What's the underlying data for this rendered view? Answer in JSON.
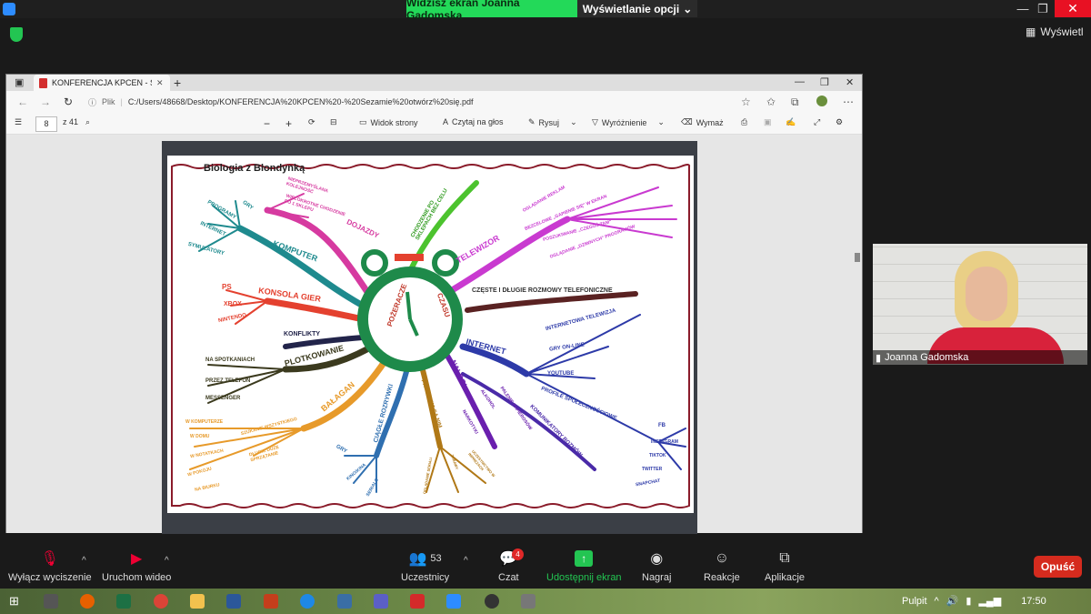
{
  "zoom": {
    "share_banner": "Widzisz ekran Joanna Gadomska",
    "view_options": "Wyświetlanie opcji",
    "view_button": "Wyświetl",
    "participant_name": "Joanna Gadomska",
    "toolbar": {
      "mute": "Wyłącz wyciszenie",
      "video": "Uruchom wideo",
      "participants": "Uczestnicy",
      "participants_count": "53",
      "chat": "Czat",
      "chat_badge": "4",
      "share": "Udostępnij ekran",
      "record": "Nagraj",
      "reactions": "Reakcje",
      "apps": "Aplikacje",
      "leave": "Opuść"
    }
  },
  "browser": {
    "tab_title": "KONFERENCJA KPCEN - Sezami",
    "file_label": "Plik",
    "url": "C:/Users/48668/Desktop/KONFERENCJA%20KPCEN%20-%20Sezamie%20otwórz%20się.pdf",
    "pdf_toolbar": {
      "page_current": "8",
      "page_total": "z 41",
      "page_view": "Widok strony",
      "read_aloud": "Czytaj na głos",
      "draw": "Rysuj",
      "highlight": "Wyróżnienie",
      "erase": "Wymaż"
    }
  },
  "mindmap": {
    "title": "Biologia z Blondynką",
    "center_left": "POŻERACZE",
    "center_right": "CZASU",
    "branches": {
      "dojazdy": "DOJAZDY",
      "dojazdy_sub": [
        "NIEPRZEMYŚLANA KOLEJNOŚĆ",
        "WIELOKROTNE CHODZENIE DO 1 SKLEPU"
      ],
      "zakupy": "CHODZENIE PO SKLEPACH BEZ CELU",
      "telewizor": "TELEWIZOR",
      "telewizor_sub": [
        "OGLĄDANIE REKLAM",
        "BEZCELOWE „GAPIENIE SIĘ\" W EKRAN",
        "POSZUKIWANIE „CZEGOŚ TAM\"",
        "OGLĄDANIE „DZIWNYCH\" PROGRAMÓW"
      ],
      "komputer": "KOMPUTER",
      "komputer_sub": [
        "GRY",
        "PROGRAMY",
        "INTERNET",
        "SYMULATORY"
      ],
      "konsola": "KONSOLA GIER",
      "konsola_sub": [
        "PS",
        "XBOX",
        "NINTENDO"
      ],
      "telefon": "CZĘSTE I DŁUGIE ROZMOWY TELEFONICZNE",
      "konflikty": "KONFLIKTY",
      "plotkowanie": "PLOTKOWANIE",
      "plotkowanie_sub": [
        "NA SPOTKANIACH",
        "PRZEZ TELEFON",
        "MESSENGER"
      ],
      "balagan": "BAŁAGAN",
      "balagan_sub": [
        "W KOMPUTERZE",
        "W DOMU",
        "W NOTATKACH",
        "W POKOJU",
        "NA BIURKU",
        "SZUKANIE WSZYSTKIEGO",
        "DŁUGIE DUŻE SPRZĄTANIE"
      ],
      "rozrywki": "CIĄGŁE ROZRYWKI",
      "rozrywki_sub": [
        "GRY",
        "KINO/KINA",
        "SERIALE"
      ],
      "przyjecia": "PRZYJĘCIA SĄ NIM",
      "przyjecia_sub": [
        "OGLĄDANIE SERIALI",
        "ZABAWY",
        "UCZESTNICTWO W IMPREZACH"
      ],
      "nalogi": "NAŁOGI",
      "nalogi_sub": [
        "PALENIE PAPIEROSÓW",
        "ALKOHOL",
        "HAZARD",
        "NARKOTYKI"
      ],
      "internet": "INTERNET",
      "internet_sub": [
        "INTERNETOWA TELEWIZJA",
        "GRY ON-LINE",
        "YOUTUBE",
        "PROFILE SPOŁECZNOŚCIOWE",
        "KOMUNIKATORY ROZMÓW",
        "FB",
        "INSTAGRAM",
        "TIKTOK",
        "TWITTER",
        "SNAPCHAT"
      ]
    }
  },
  "taskbar": {
    "desktop": "Pulpit",
    "time": "17:50"
  }
}
